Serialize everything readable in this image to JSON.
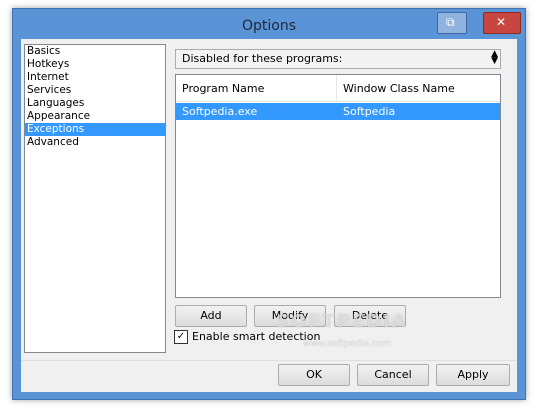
{
  "window": {
    "title": "Options",
    "restore_glyph": "⧉",
    "close_glyph": "✕"
  },
  "nav": {
    "items": [
      {
        "label": "Basics",
        "selected": false
      },
      {
        "label": "Hotkeys",
        "selected": false
      },
      {
        "label": "Internet",
        "selected": false
      },
      {
        "label": "Services",
        "selected": false
      },
      {
        "label": "Languages",
        "selected": false
      },
      {
        "label": "Appearance",
        "selected": false
      },
      {
        "label": "Exceptions",
        "selected": true
      },
      {
        "label": "Advanced",
        "selected": false
      }
    ]
  },
  "exceptions": {
    "mode_select": {
      "value": "Disabled for these programs:",
      "arrow": "▲▼"
    },
    "columns": [
      "Program Name",
      "Window Class Name"
    ],
    "rows": [
      {
        "program": "Softpedia.exe",
        "window_class": "Softpedia"
      }
    ],
    "buttons": {
      "add": "Add",
      "modify": "Modify",
      "delete": "Delete"
    },
    "smart_detection": {
      "label": "Enable smart detection",
      "checked": true,
      "check_glyph": "✓"
    }
  },
  "dialog_buttons": {
    "ok": "OK",
    "cancel": "Cancel",
    "apply": "Apply"
  },
  "watermark": {
    "text": "SOFTPEDIA",
    "url": "www.softpedia.com"
  },
  "colors": {
    "selection": "#3399ff",
    "close_button": "#c7463f",
    "window_frame": "#5a93d6"
  }
}
